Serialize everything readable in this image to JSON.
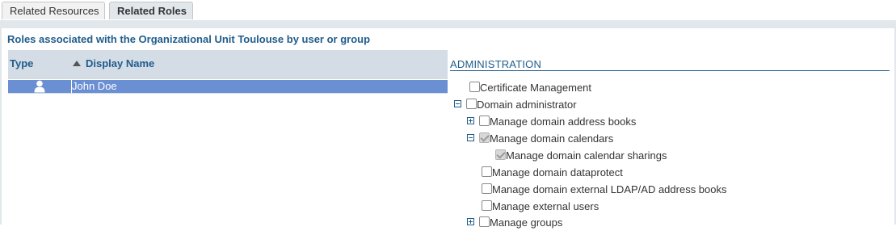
{
  "tabs": [
    {
      "label": "Related Resources",
      "active": false
    },
    {
      "label": "Related Roles",
      "active": true
    }
  ],
  "section_title": "Roles associated with the Organizational Unit Toulouse by user or group",
  "grid": {
    "columns": {
      "type": "Type",
      "display_name": "Display Name"
    },
    "sort": "ascending",
    "rows": [
      {
        "type_icon": "user-icon",
        "display_name": "John Doe",
        "selected": true
      }
    ]
  },
  "tree": {
    "header": "ADMINISTRATION",
    "items": [
      {
        "label": "Certificate Management",
        "checked": false,
        "toggle": "none"
      },
      {
        "label": "Domain administrator",
        "checked": false,
        "toggle": "collapse"
      },
      {
        "label": "Manage domain address books",
        "checked": false,
        "toggle": "expand"
      },
      {
        "label": "Manage domain calendars",
        "checked": true,
        "toggle": "collapse"
      },
      {
        "label": "Manage domain calendar sharings",
        "checked": true,
        "toggle": "none"
      },
      {
        "label": "Manage domain dataprotect",
        "checked": false,
        "toggle": "none"
      },
      {
        "label": "Manage domain external LDAP/AD address books",
        "checked": false,
        "toggle": "none"
      },
      {
        "label": "Manage external users",
        "checked": false,
        "toggle": "none"
      },
      {
        "label": "Manage groups",
        "checked": false,
        "toggle": "expand"
      }
    ]
  },
  "colors": {
    "accent": "#1f5c8c",
    "selected_row": "#6b8fd3",
    "header_bg": "#d4dce6",
    "tab_strip": "#e2e7ec"
  }
}
